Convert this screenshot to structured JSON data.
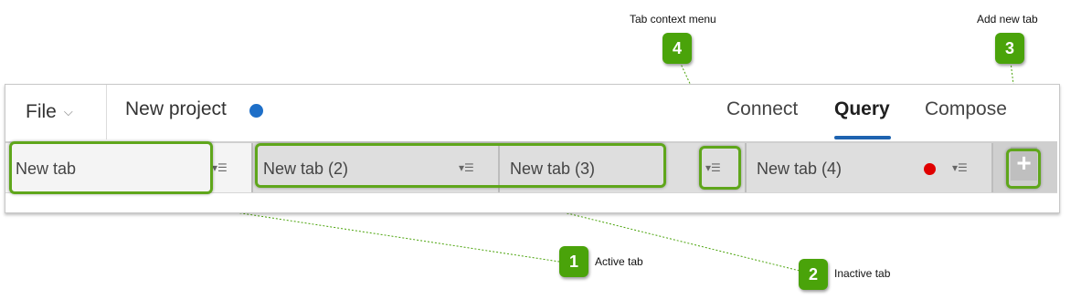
{
  "header": {
    "file_menu": {
      "label": "File",
      "icon": "chevron-down-icon",
      "glyph": "⌵"
    },
    "project_title": "New project",
    "project_status_color": "#1e6fc8",
    "nav_tabs": [
      {
        "label": "Connect",
        "active": false
      },
      {
        "label": "Query",
        "active": true
      },
      {
        "label": "Compose",
        "active": false
      }
    ]
  },
  "tabs": [
    {
      "label": "New tab",
      "active": true,
      "menu_glyph": "▾☰"
    },
    {
      "label": "New tab (2)",
      "active": false,
      "menu_glyph": "▾☰"
    },
    {
      "label": "New tab (3)",
      "active": false,
      "menu_glyph": "▾☰"
    },
    {
      "label": "New tab (4)",
      "active": false,
      "menu_glyph": "▾☰",
      "status_color": "#e00000"
    }
  ],
  "add_tab": {
    "glyph": "+"
  },
  "callouts": [
    {
      "number": "1",
      "label": "Active tab"
    },
    {
      "number": "2",
      "label": "Inactive tab"
    },
    {
      "number": "3",
      "label": "Add new tab"
    },
    {
      "number": "4",
      "label": "Tab context menu"
    }
  ],
  "colors": {
    "callout_green": "#4aa30a",
    "highlight_green": "#5fa61b",
    "nav_active_underline": "#1e63b0"
  }
}
